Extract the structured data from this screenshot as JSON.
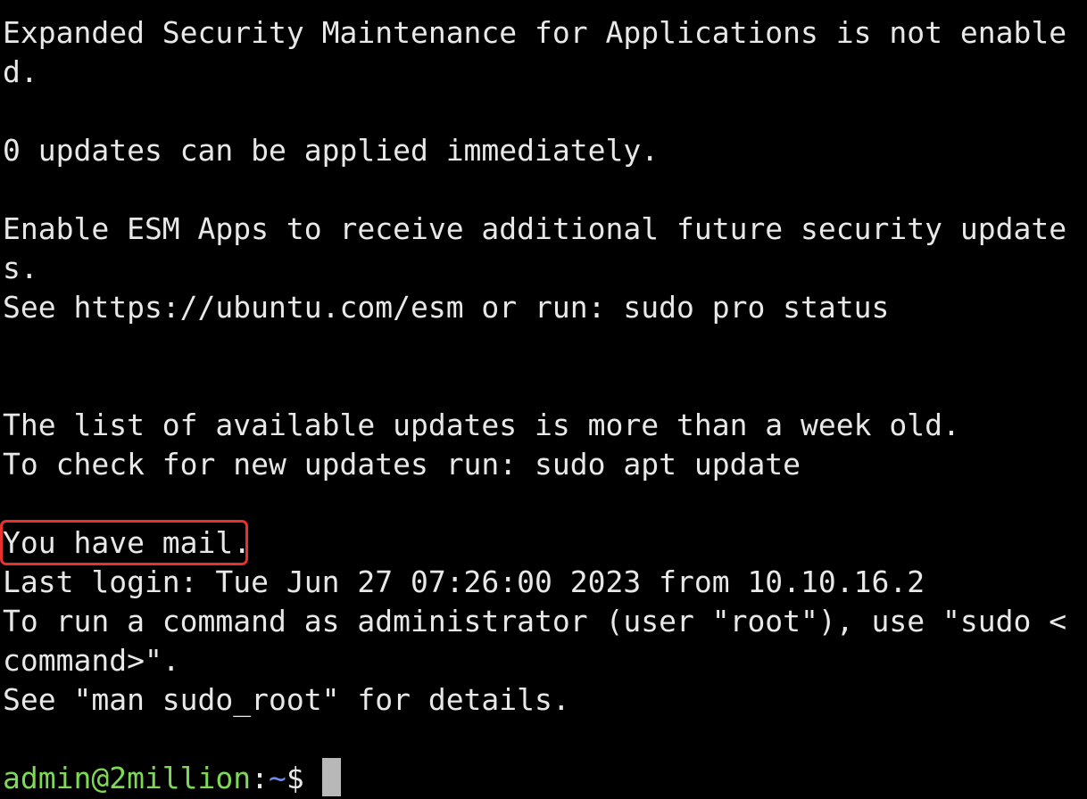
{
  "terminal": {
    "lines": [
      "Expanded Security Maintenance for Applications is not enable",
      "d.",
      "",
      "0 updates can be applied immediately.",
      "",
      "Enable ESM Apps to receive additional future security update",
      "s.",
      "See https://ubuntu.com/esm or run: sudo pro status",
      "",
      "",
      "The list of available updates is more than a week old.",
      "To check for new updates run: sudo apt update",
      "",
      "You have mail.",
      "Last login: Tue Jun 27 07:26:00 2023 from 10.10.16.2",
      "To run a command as administrator (user \"root\"), use \"sudo <",
      "command>\".",
      "See \"man sudo_root\" for details.",
      "",
      ""
    ],
    "prompt": {
      "user_host": "admin@2million",
      "separator": ":",
      "path": "~",
      "symbol": "$ "
    },
    "highlighted_text": "You have mail.",
    "colors": {
      "background": "#000000",
      "text": "#e8e8e8",
      "user_host": "#7ed957",
      "path": "#6c8cf0",
      "highlight_border": "#e8312a",
      "cursor": "#b8b8b8"
    }
  }
}
